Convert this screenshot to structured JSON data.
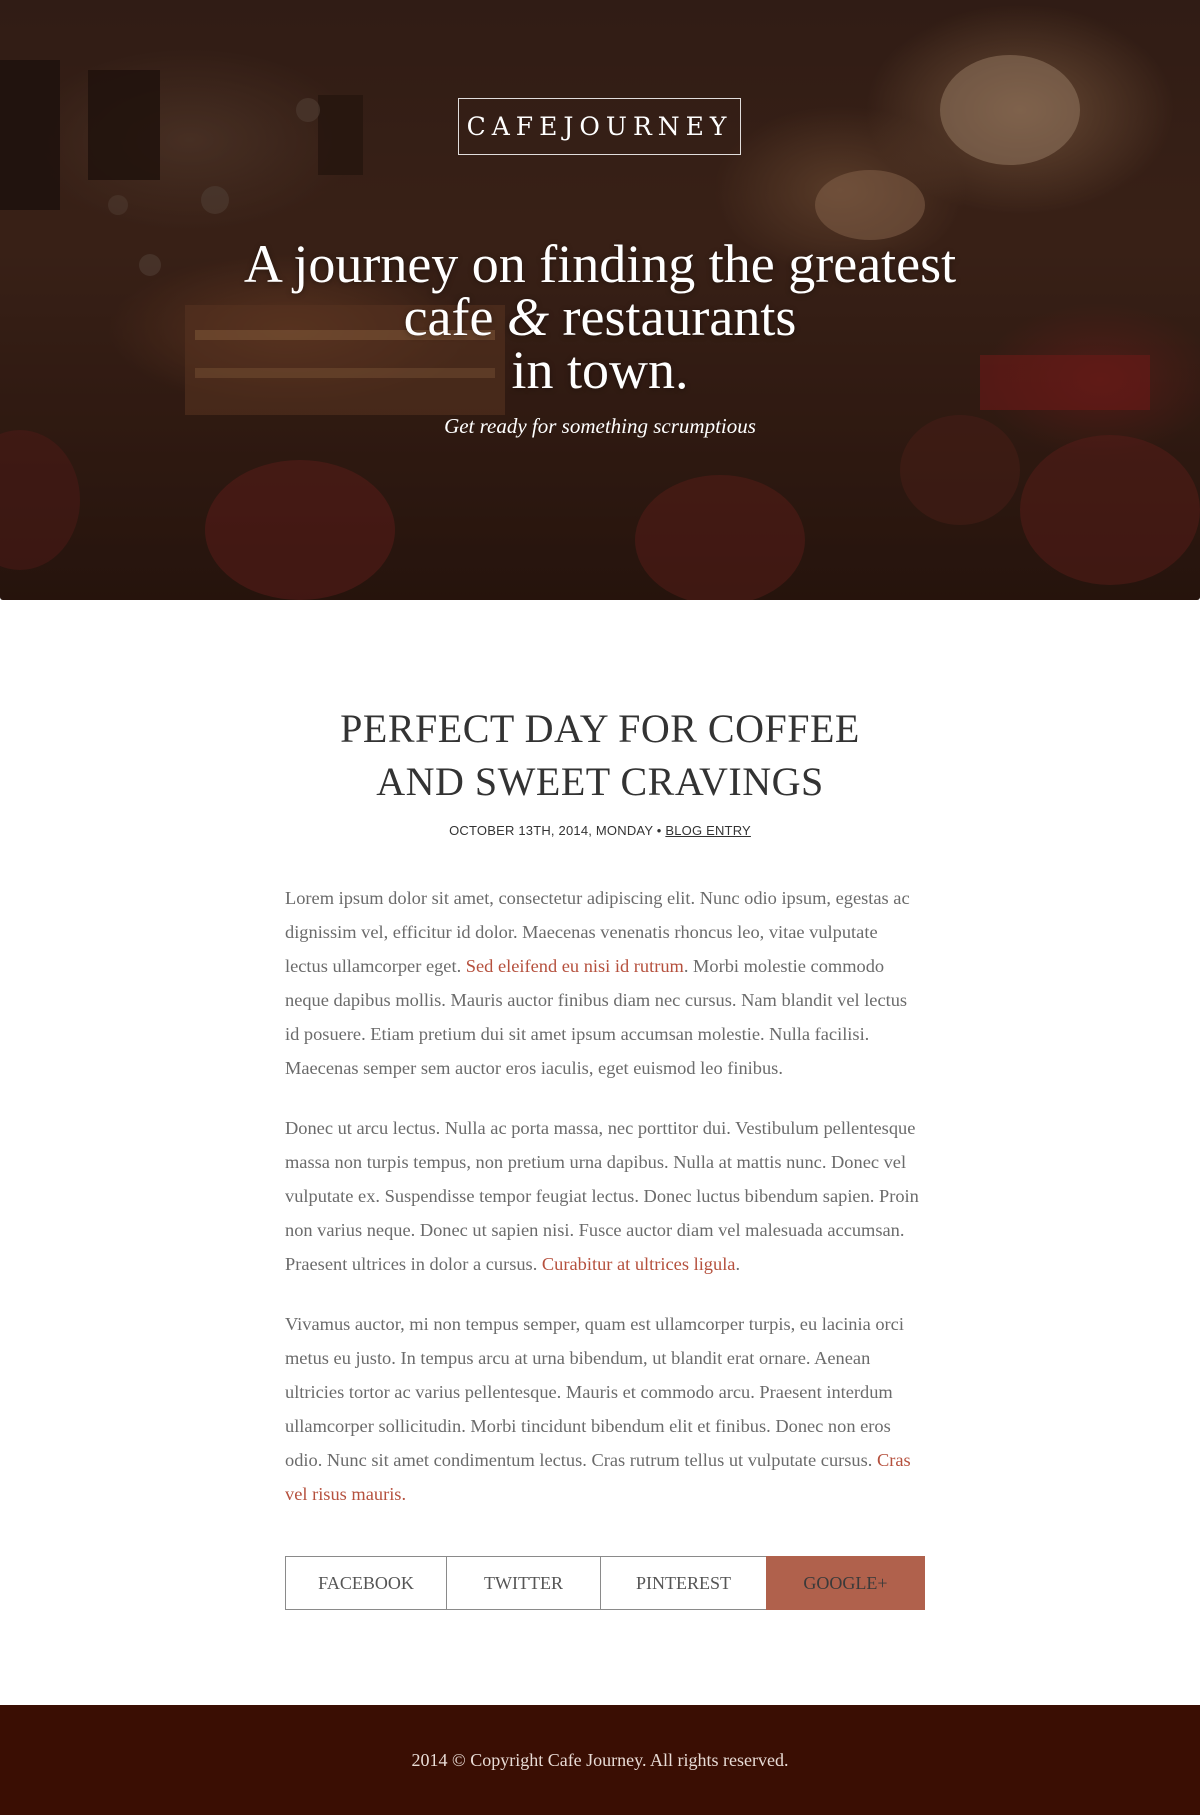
{
  "hero": {
    "logo": "CAFEJOURNEY",
    "headline_line1": "A journey on finding the greatest",
    "headline_line2a": "cafe",
    "headline_amp": "&",
    "headline_line2b": "restaurants",
    "headline_line3": "in town.",
    "subtitle": "Get ready for something scrumptious"
  },
  "post": {
    "title_line1": "PERFECT DAY FOR COFFEE",
    "title_line2": "AND SWEET CRAVINGS",
    "date": "OCTOBER 13TH, 2014, MONDAY",
    "separator": "•",
    "category": "BLOG ENTRY",
    "p1_before": "Lorem ipsum dolor sit amet, consectetur adipiscing elit. Nunc odio ipsum, egestas ac dignissim vel, efficitur id dolor. Maecenas venenatis rhoncus leo, vitae vulputate lectus ullamcorper eget. ",
    "p1_link": "Sed eleifend eu nisi id rutrum",
    "p1_after": ". Morbi molestie commodo neque dapibus mollis. Mauris auctor finibus diam nec cursus. Nam blandit vel lectus id posuere. Etiam pretium dui sit amet ipsum accumsan molestie. Nulla facilisi. Maecenas semper sem auctor eros iaculis, eget euismod leo finibus.",
    "p2_before": "Donec ut arcu lectus. Nulla ac porta massa, nec porttitor dui. Vestibulum pellen­tesque massa non turpis tempus, non pretium urna dapibus. Nulla at mattis nunc. Donec vel vulputate ex. Suspendisse tempor feugiat lectus. Donec luctus bibendum sapien. Proin non varius neque. Donec ut sapien nisi. Fusce auctor diam vel male­suada accumsan. Praesent ultrices in dolor a cursus. ",
    "p2_link": "Curabitur at ultrices ligula",
    "p2_after": ".",
    "p3_before": "Vivamus auctor, mi non tempus semper, quam est ullamcorper turpis, eu lacinia orci metus eu justo. In tempus arcu at urna bibendum, ut blandit erat ornare. Aenean ultricies tortor ac varius pellentesque. Mauris et commodo arcu. Praesent interdum ullamcorper sollicitudin. Morbi tincidunt bibendum elit et finibus. Donec non eros odio. Nunc sit amet condimentum lectus. Cras rutrum tellus ut vulputate cursus. ",
    "p3_link": "Cras vel risus mauris."
  },
  "share": {
    "facebook": "FACEBOOK",
    "twitter": "TWITTER",
    "pinterest": "PINTEREST",
    "googleplus": "GOOGLE+"
  },
  "footer": {
    "copyright": "2014 © Copyright Cafe Journey. All rights reserved."
  },
  "colors": {
    "accent": "#b0614c",
    "link": "#b5503d",
    "footer_bg": "#3a0e03"
  }
}
